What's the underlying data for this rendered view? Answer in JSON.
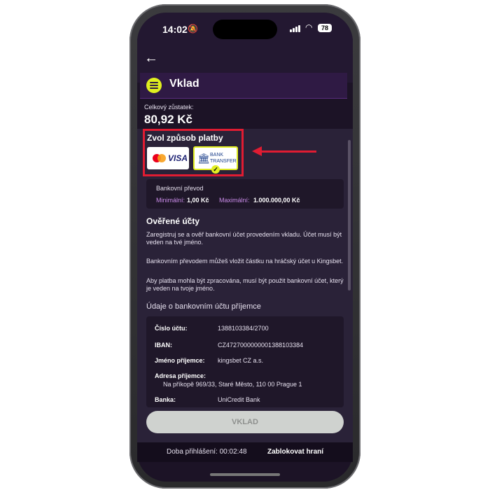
{
  "status_bar": {
    "time": "14:02",
    "battery": "78",
    "bell_icon": "bell-slash-icon",
    "wifi_icon": "wifi-icon",
    "signal_icon": "signal-icon"
  },
  "nav": {
    "back_icon": "arrow-left-icon"
  },
  "header": {
    "menu_icon": "hamburger-menu-icon",
    "title": "Vklad"
  },
  "balance": {
    "label": "Celkový zůstatek:",
    "value": "80,92 Kč"
  },
  "payment": {
    "title": "Zvol způsob platby",
    "methods": [
      {
        "name": "card",
        "mastercard_label": "mastercard",
        "visa_label": "VISA"
      },
      {
        "name": "bank-transfer",
        "line1": "BANK",
        "line2": "TRANSFER",
        "selected": true
      }
    ],
    "selected_check": "✓"
  },
  "method_info": {
    "name": "Bankovní převod",
    "min_label": "Minimální:",
    "min_value": "1,00 Kč",
    "max_label": "Maximální:",
    "max_value": "1.000.000,00 Kč"
  },
  "verified": {
    "title": "Ověřené účty",
    "chevron_icon": "chevron-up-icon",
    "p1": "Zaregistruj se a ověř bankovní účet provedením vkladu. Účet musí být veden na tvé jméno.",
    "p2": "Bankovním převodem můžeš vložit částku na hráčský účet u Kingsbet.",
    "p3": "Aby platba mohla být zpracována, musí být použit bankovní účet, který je veden na tvoje jméno."
  },
  "recipient": {
    "title": "Údaje o bankovním účtu příjemce",
    "account_label": "Číslo účtu:",
    "account_value": "1388103384/2700",
    "iban_label": "IBAN:",
    "iban_value": "CZ4727000000001388103384",
    "name_label": "Jméno příjemce:",
    "name_value": "kingsbet CZ a.s.",
    "address_label": "Adresa příjemce:",
    "address_value": "Na příkopě 969/33, Staré Město, 110 00 Prague 1",
    "bank_label": "Banka:",
    "bank_value": "UniCredit Bank"
  },
  "deposit_button": "VKLAD",
  "footer": {
    "login_time": "Doba přihlášení: 00:02:48",
    "block": "Zablokovat hraní"
  },
  "colors": {
    "background": "#1c1326",
    "accent": "#e2ef22",
    "highlight": "#e01c32",
    "label_purple": "#c98be8"
  }
}
